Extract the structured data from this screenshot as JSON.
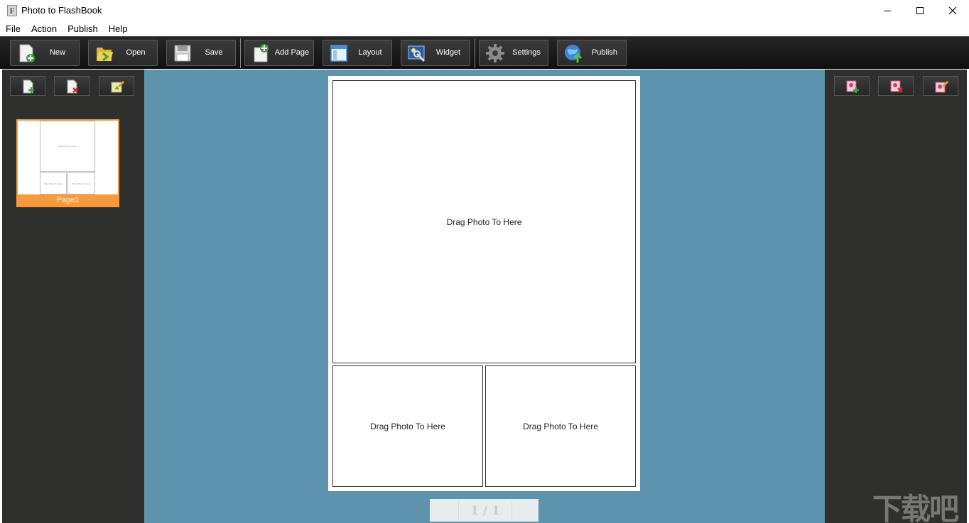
{
  "window": {
    "title": "Photo to FlashBook",
    "app_icon_letter": "F"
  },
  "menu": {
    "items": [
      "File",
      "Action",
      "Publish",
      "Help"
    ]
  },
  "toolbar": {
    "new_label": "New",
    "open_label": "Open",
    "save_label": "Save",
    "add_page_label": "Add Page",
    "layout_label": "Layout",
    "widget_label": "Widget",
    "settings_label": "Settings",
    "publish_label": "Publish"
  },
  "pages_panel": {
    "thumbnails": [
      {
        "label": "Page1",
        "cell_text": "Drag Photo To Here"
      }
    ]
  },
  "page": {
    "drop_zones": [
      "Drag Photo To Here",
      "Drag Photo To Here",
      "Drag Photo To Here"
    ]
  },
  "pager": {
    "text": "1 / 1"
  },
  "watermark": {
    "text": "下载吧"
  },
  "colors": {
    "canvas_bg": "#5d93ac",
    "panel_bg": "#2f2f2d",
    "thumb_selected": "#f59a3d",
    "toolbar_bg": "#1c1c1c"
  }
}
